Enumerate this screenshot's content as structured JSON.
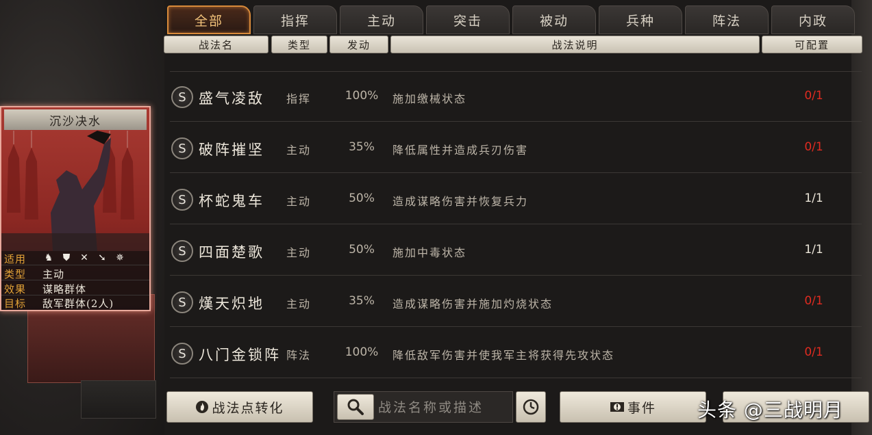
{
  "tabs": [
    {
      "label": "全部",
      "active": true
    },
    {
      "label": "指挥",
      "active": false
    },
    {
      "label": "主动",
      "active": false
    },
    {
      "label": "突击",
      "active": false
    },
    {
      "label": "被动",
      "active": false
    },
    {
      "label": "兵种",
      "active": false
    },
    {
      "label": "阵法",
      "active": false
    },
    {
      "label": "内政",
      "active": false
    }
  ],
  "columns": {
    "name": "战法名",
    "type": "类型",
    "rate": "发动",
    "desc": "战法说明",
    "count": "可配置"
  },
  "tactics": [
    {
      "grade": "S",
      "name": "盛气凌敌",
      "type": "指挥",
      "rate": "100%",
      "desc": "施加缴械状态",
      "count": "0/1",
      "count_color": "#e02b20"
    },
    {
      "grade": "S",
      "name": "破阵摧坚",
      "type": "主动",
      "rate": "35%",
      "desc": "降低属性并造成兵刃伤害",
      "count": "0/1",
      "count_color": "#e02b20"
    },
    {
      "grade": "S",
      "name": "杯蛇鬼车",
      "type": "主动",
      "rate": "50%",
      "desc": "造成谋略伤害并恢复兵力",
      "count": "1/1",
      "count_color": "#ece6da"
    },
    {
      "grade": "S",
      "name": "四面楚歌",
      "type": "主动",
      "rate": "50%",
      "desc": "施加中毒状态",
      "count": "1/1",
      "count_color": "#ece6da"
    },
    {
      "grade": "S",
      "name": "熯天炽地",
      "type": "主动",
      "rate": "35%",
      "desc": "造成谋略伤害并施加灼烧状态",
      "count": "0/1",
      "count_color": "#e02b20"
    },
    {
      "grade": "S",
      "name": "八门金锁阵",
      "type": "阵法",
      "rate": "100%",
      "desc": "降低敌军伤害并使我军主将获得先攻状态",
      "count": "0/1",
      "count_color": "#e02b20"
    }
  ],
  "card": {
    "title": "沉沙决水",
    "applicable_label": "适用",
    "arms_icons": [
      "cavalry-icon",
      "shield-icon",
      "bow-icon",
      "spear-icon",
      "wheel-icon"
    ],
    "type_label": "类型",
    "type_value": "主动",
    "effect_label": "效果",
    "effect_value": "谋略群体",
    "target_label": "目标",
    "target_value": "敌军群体(2人)"
  },
  "bottom": {
    "convert_label": "战法点转化",
    "search_placeholder": "战法名称或描述",
    "event_label": "事件"
  },
  "watermark": "头条 @三战明月",
  "colors": {
    "accent": "#d88a3a",
    "red_count": "#e02b20",
    "label_gold": "#e2a237"
  }
}
